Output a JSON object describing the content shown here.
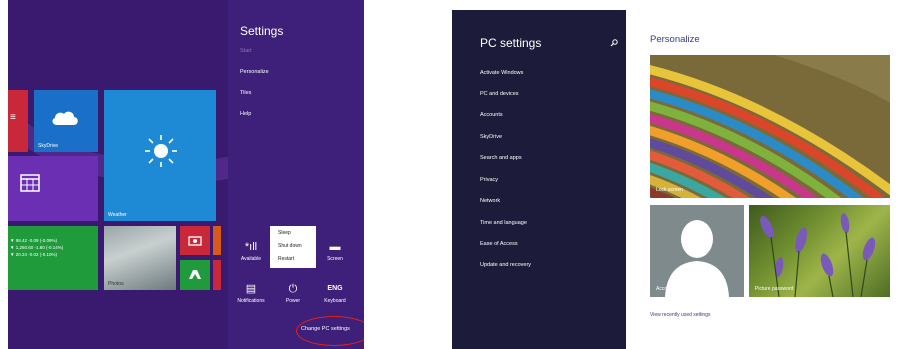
{
  "start_screen": {
    "tiles": {
      "skydrive_label": "SkyDrive",
      "weather_label": "Weather",
      "photos_label": "Photos",
      "finance": [
        "▼ 98.42 -0.09 (-0.09%)",
        "▼ 1,260.60 -1.80 (-0.14%)",
        "▼ 20.24 -0.02 (-0.10%)"
      ]
    }
  },
  "settings_charm": {
    "title": "Settings",
    "items": [
      "Start",
      "Personalize",
      "Tiles",
      "Help"
    ],
    "quick": {
      "network": "Available",
      "screen": "Screen",
      "notifications": "Notifications",
      "power": "Power",
      "keyboard_glyph": "ENG",
      "keyboard": "Keyboard"
    },
    "power_menu": [
      "Sleep",
      "Shut down",
      "Restart"
    ],
    "change_pc_settings": "Change PC settings"
  },
  "pc_settings": {
    "title": "PC settings",
    "items": [
      "Activate Windows",
      "PC and devices",
      "Accounts",
      "SkyDrive",
      "Search and apps",
      "Privacy",
      "Network",
      "Time and language",
      "Ease of Access",
      "Update and recovery"
    ],
    "personalize": {
      "title": "Personalize",
      "lock_screen": "Lock screen",
      "account_picture": "Account picture",
      "picture_password": "Picture password",
      "recent": "View recently used settings"
    }
  },
  "colors": {
    "accent_purple": "#3e1f7a",
    "pc_sidebar": "#1c1c3a",
    "highlight_red": "#e02020"
  }
}
